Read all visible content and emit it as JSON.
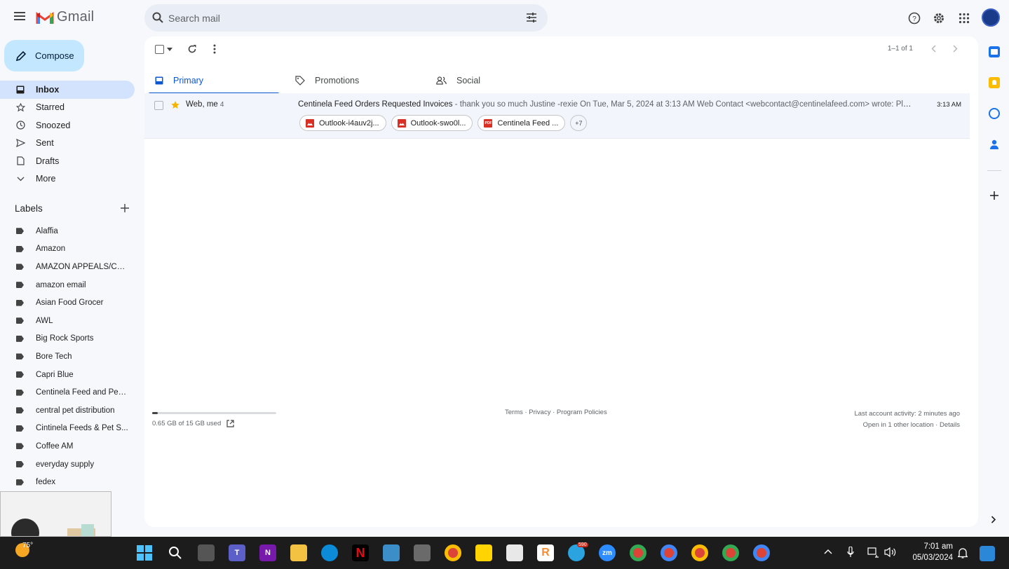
{
  "app": {
    "name": "Gmail"
  },
  "search": {
    "placeholder": "Search mail"
  },
  "compose": {
    "label": "Compose"
  },
  "nav": [
    {
      "label": "Inbox",
      "icon": "inbox-icon",
      "active": true
    },
    {
      "label": "Starred",
      "icon": "star-icon"
    },
    {
      "label": "Snoozed",
      "icon": "clock-icon"
    },
    {
      "label": "Sent",
      "icon": "send-icon"
    },
    {
      "label": "Drafts",
      "icon": "draft-icon"
    },
    {
      "label": "More",
      "icon": "chevron-down-icon"
    }
  ],
  "labels": {
    "title": "Labels",
    "items": [
      "Alaffia",
      "Amazon",
      "AMAZON APPEALS/CAS...",
      "amazon email",
      "Asian Food Grocer",
      "AWL",
      "Big Rock Sports",
      "Bore Tech",
      "Capri Blue",
      "Centinela Feed and Pet ...",
      "central pet distribution",
      "Cintinela Feeds & Pet S...",
      "Coffee AM",
      "everyday supply",
      "fedex"
    ]
  },
  "toolbar": {
    "pager": "1–1 of 1"
  },
  "tabs": [
    {
      "label": "Primary",
      "active": true
    },
    {
      "label": "Promotions"
    },
    {
      "label": "Social"
    }
  ],
  "email": {
    "sender": "Web, me",
    "count": "4",
    "subject": "Centinela Feed Orders Requested Invoices",
    "snippet": " - thank you so much Justine -rexie On Tue, Mar 5, 2024 at 3:13 AM Web Contact <webcontact@centinelafeed.com> wrote: Plea...",
    "time": "3:13 AM",
    "attachments": [
      {
        "name": "Outlook-i4auv2j...",
        "type": "image"
      },
      {
        "name": "Outlook-swo0l...",
        "type": "image"
      },
      {
        "name": "Centinela Feed ...",
        "type": "pdf"
      }
    ],
    "more_attachments": "+7"
  },
  "footer": {
    "storage": "0.65 GB of 15 GB used",
    "storage_fraction": 0.043,
    "links": "Terms · Privacy · Program Policies",
    "activity": "Last account activity: 2 minutes ago",
    "location": "Open in 1 other location · Details"
  },
  "taskbar": {
    "weather": "75°",
    "telegram_badge": "590",
    "time": "7:01 am",
    "date": "05/03/2024"
  },
  "colors": {
    "accent": "#0b57d0",
    "compose_bg": "#c2e7ff",
    "active_nav": "#d3e3fd",
    "background": "#f6f8fc"
  }
}
